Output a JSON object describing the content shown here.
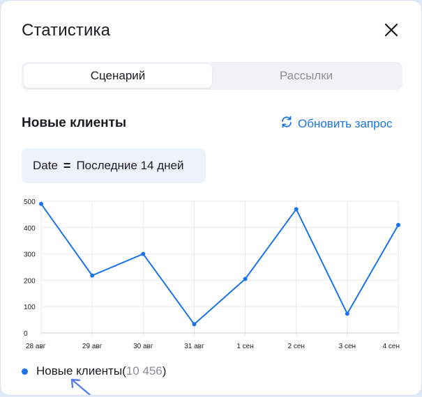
{
  "modal": {
    "title": "Статистика",
    "close_icon": "close-icon"
  },
  "tabs": [
    {
      "label": "Сценарий",
      "active": true
    },
    {
      "label": "Рассылки",
      "active": false
    }
  ],
  "section": {
    "title": "Новые клиенты",
    "refresh_label": "Обновить запрос",
    "refresh_icon": "refresh-icon"
  },
  "filter": {
    "field": "Date",
    "operator": "=",
    "value": "Последние 14 дней"
  },
  "legend": {
    "name": "Новые клиенты",
    "open": " (",
    "count": "10 456",
    "close": ")"
  },
  "colors": {
    "accent": "#1a73e8",
    "line": "#1a73e8"
  },
  "chart_data": {
    "type": "line",
    "categories": [
      "28 авг",
      "29 авг",
      "30 авг",
      "31 авг",
      "1 сен",
      "2 сен",
      "3 сен",
      "4 сен"
    ],
    "series": [
      {
        "name": "Новые клиенты",
        "values": [
          490,
          218,
          300,
          33,
          205,
          470,
          73,
          410
        ]
      }
    ],
    "yticks": [
      "0",
      "100",
      "200",
      "300",
      "400",
      "500"
    ],
    "ylim": [
      0,
      500
    ],
    "grid": true
  }
}
